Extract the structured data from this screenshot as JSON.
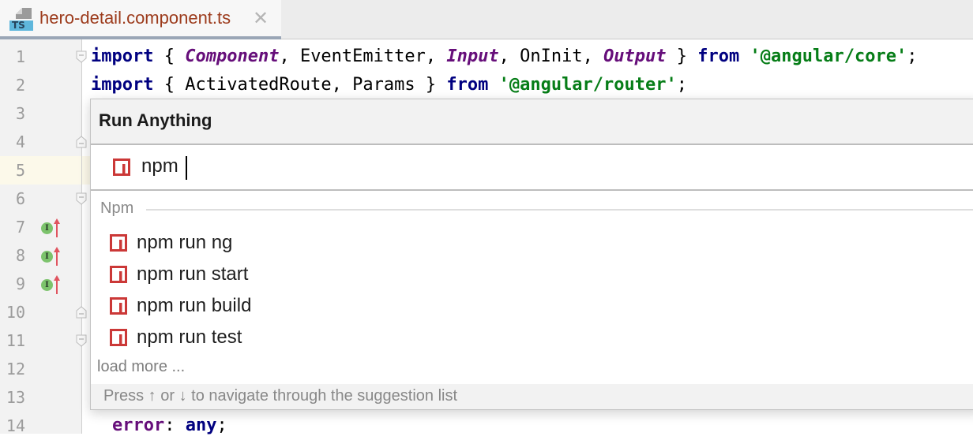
{
  "tab": {
    "icon": "typescript-file-icon",
    "icon_badge": "TS",
    "title": "hero-detail.component.ts",
    "close_glyph": "✕"
  },
  "editor": {
    "current_line": 5,
    "lines": [
      {
        "n": "1"
      },
      {
        "n": "2"
      },
      {
        "n": "3"
      },
      {
        "n": "4"
      },
      {
        "n": "5"
      },
      {
        "n": "6"
      },
      {
        "n": "7"
      },
      {
        "n": "8"
      },
      {
        "n": "9"
      },
      {
        "n": "10"
      },
      {
        "n": "11"
      },
      {
        "n": "12"
      },
      {
        "n": "13"
      },
      {
        "n": "14"
      }
    ],
    "gutter_markers": {
      "impl_glyph": "I"
    },
    "code": {
      "l1": {
        "kw_import": "import",
        "t1": " { ",
        "c1": "Component",
        "t2": ", EventEmitter, ",
        "c2": "Input",
        "t3": ", OnInit, ",
        "c3": "Output",
        "t4": " } ",
        "kw_from": "from",
        "t5": " ",
        "s1": "'@angular/core'",
        "t6": ";"
      },
      "l2": {
        "kw_import": "import",
        "t1": " { ActivatedRoute, Params } ",
        "kw_from": "from",
        "t2": " ",
        "s1": "'@angular/router'",
        "t3": ";"
      },
      "l14": {
        "field": "error",
        "t1": ": ",
        "kw_any": "any",
        "t2": ";"
      }
    }
  },
  "popup": {
    "title": "Run Anything",
    "search": {
      "value": "npm",
      "placeholder": ""
    },
    "group_label": "Npm",
    "results": [
      {
        "label": "npm run ng"
      },
      {
        "label": "npm run start"
      },
      {
        "label": "npm run build"
      },
      {
        "label": "npm run test"
      }
    ],
    "load_more": "load more ...",
    "footer_hint": "Press ↑ or ↓ to navigate through the suggestion list"
  },
  "colors": {
    "npm_red": "#cb3837",
    "keyword": "#000080",
    "class": "#660e7a",
    "string": "#067d17",
    "tab_title": "#9c3b1c",
    "current_line_bg": "#fcf9ea"
  }
}
